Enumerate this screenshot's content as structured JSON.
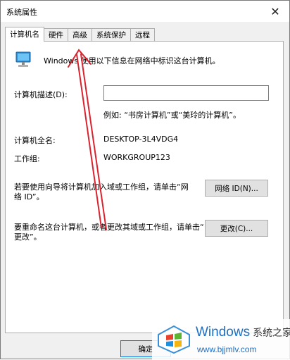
{
  "window": {
    "title": "系统属性",
    "close_glyph": "✕"
  },
  "tabs": [
    {
      "label": "计算机名",
      "active": true
    },
    {
      "label": "硬件"
    },
    {
      "label": "高级"
    },
    {
      "label": "系统保护"
    },
    {
      "label": "远程"
    }
  ],
  "panel": {
    "intro": "Windows 使用以下信息在网络中标识这台计算机。",
    "description_label": "计算机描述(D):",
    "description_value": "",
    "description_example": "例如: “书房计算机”或“美玲的计算机”。",
    "full_name_label": "计算机全名:",
    "full_name_value": "DESKTOP-3L4VDG4",
    "workgroup_label": "工作组:",
    "workgroup_value": "WORKGROUP123",
    "network_text_line1": "若要使用向导将计算机加入域或工作组，请单击“网",
    "network_text_line2": "络 ID”。",
    "network_button": "网络 ID(N)...",
    "rename_text_line1": "要重命名这台计算机，或者更改其域或工作组，请单击“",
    "rename_text_line2": "更改”。",
    "change_button": "更改(C)..."
  },
  "footer": {
    "ok_button": "确定"
  },
  "watermark": {
    "brand": "Windows",
    "brand_cn": "系统之家",
    "url": "www.bjjmlv.com"
  },
  "colors": {
    "accent": "#0078d7",
    "annotation": "#d9232f"
  }
}
